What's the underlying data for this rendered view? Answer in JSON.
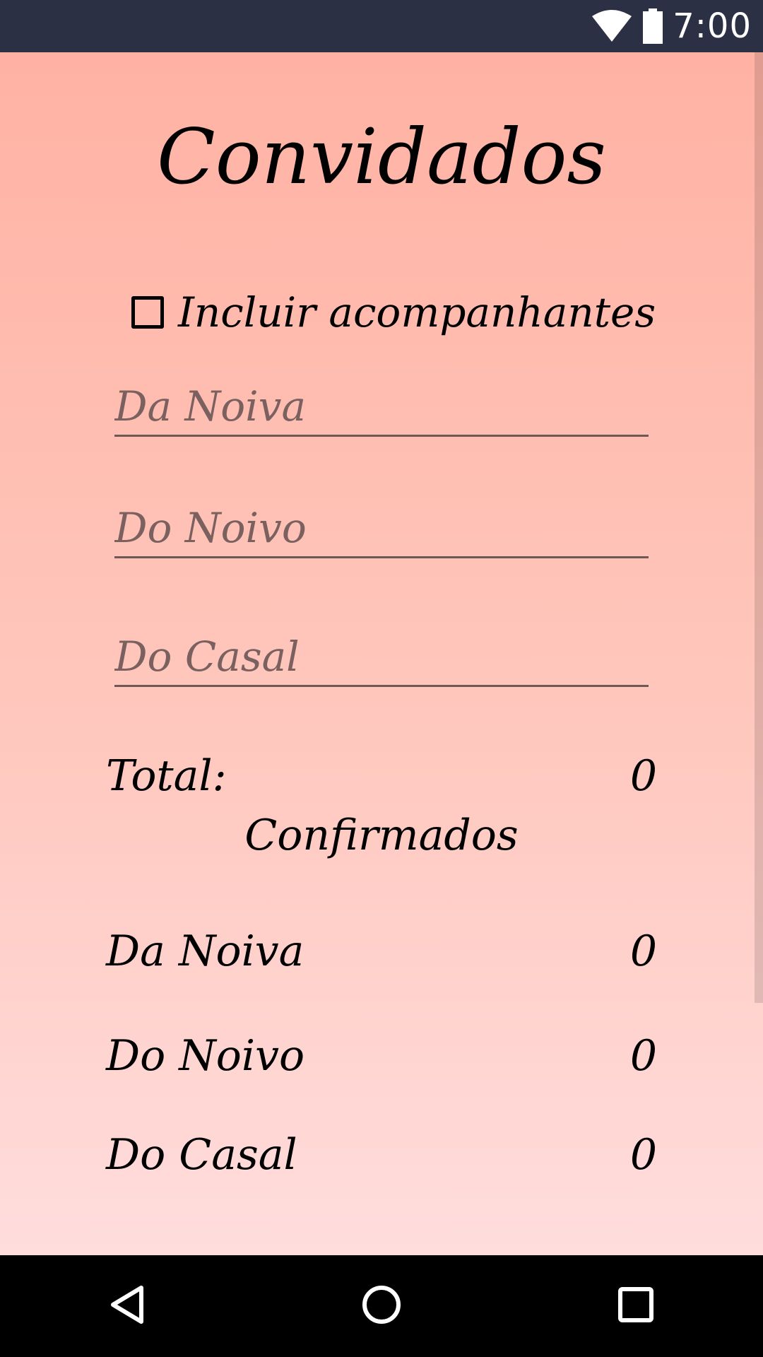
{
  "status_bar": {
    "time": "7:00",
    "icons": [
      "wifi-icon",
      "battery-icon"
    ]
  },
  "colors": {
    "status_bar_bg": "#2b3044",
    "gradient_top": "#ffb2a3",
    "gradient_bottom": "#ffdddd",
    "nav_bar_bg": "#000000"
  },
  "page": {
    "title": "Convidados"
  },
  "options": {
    "include_companions_label": "Incluir acompanhantes",
    "include_companions_checked": false
  },
  "inputs": {
    "da_noiva": {
      "placeholder": "Da Noiva",
      "value": ""
    },
    "do_noivo": {
      "placeholder": "Do Noivo",
      "value": ""
    },
    "do_casal": {
      "placeholder": "Do Casal",
      "value": ""
    }
  },
  "summary": {
    "total_label": "Total:",
    "total_value": "0",
    "confirmed_heading": "Confirmados",
    "confirmed": [
      {
        "label": "Da Noiva",
        "value": "0"
      },
      {
        "label": "Do Noivo",
        "value": "0"
      },
      {
        "label": "Do Casal",
        "value": "0"
      }
    ]
  },
  "nav_bar": {
    "buttons": [
      "back-icon",
      "home-icon",
      "recents-icon"
    ]
  }
}
